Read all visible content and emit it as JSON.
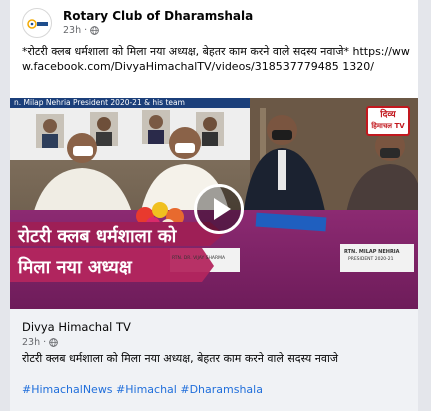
{
  "post": {
    "page_name": "Rotary Club of Dharamshala",
    "time": "23h",
    "dot": "·",
    "text": "*रोटरी क्लब धर्मशाला को मिला नया अध्यक्ष, बेहतर काम करने वाले सदस्य नवाजे* https://www.facebook.com/DivyaHimachalTV/videos/318537779485 1320/",
    "avatar_logo": "Rotary"
  },
  "video": {
    "top_strip": "n. Milap Nehria President 2020-21 & his team",
    "banner_line1": "रोटरी क्लब धर्मशाला को",
    "banner_line2": "मिला नया अध्यक्ष",
    "tv_logo_line1": "दिव्य",
    "tv_logo_line2": "हिमाचल TV",
    "nameplate_left": "RTN. DR. VIJAY SHARMA",
    "nameplate_right_1": "RTN. MILAP NEHRIA",
    "nameplate_right_2": "PRESIDENT 2020-21",
    "play_icon": "play-icon"
  },
  "caption": {
    "site": "Divya Himachal TV",
    "time": "23h",
    "dot": "·",
    "text": "रोटरी क्लब धर्मशाला को मिला नया अध्यक्ष, बेहतर काम करने वाले सदस्य नवाजे",
    "tags": "#HimachalNews #Himachal #Dharamshala"
  },
  "colors": {
    "link": "#216fdb",
    "banner_bg": "#b3265e",
    "tv_red": "#c2181e"
  }
}
